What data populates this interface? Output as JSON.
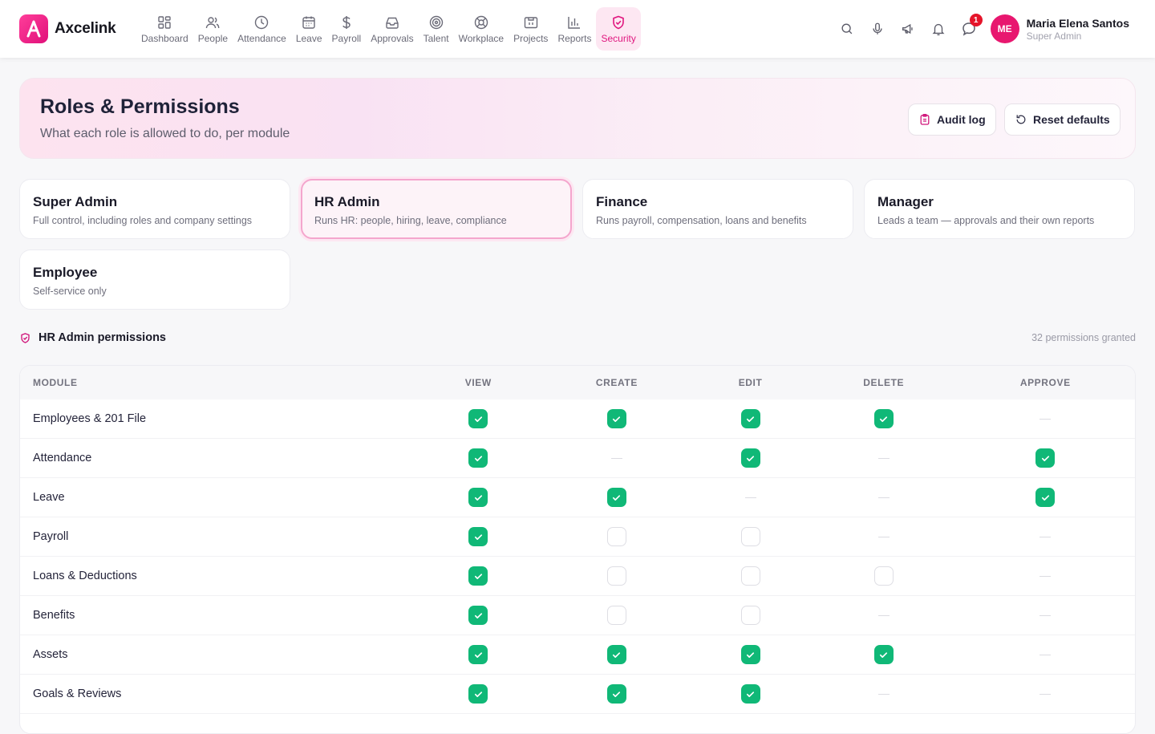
{
  "app": {
    "name": "Axcelink"
  },
  "nav": [
    {
      "label": "Dashboard",
      "icon": "grid-icon",
      "active": false
    },
    {
      "label": "People",
      "icon": "people-icon",
      "active": false
    },
    {
      "label": "Attendance",
      "icon": "clock-icon",
      "active": false
    },
    {
      "label": "Leave",
      "icon": "calendar-icon",
      "active": false
    },
    {
      "label": "Payroll",
      "icon": "dollar-icon",
      "active": false
    },
    {
      "label": "Approvals",
      "icon": "inbox-icon",
      "active": false
    },
    {
      "label": "Talent",
      "icon": "target-icon",
      "active": false
    },
    {
      "label": "Workplace",
      "icon": "lifebuoy-icon",
      "active": false
    },
    {
      "label": "Projects",
      "icon": "folder-icon",
      "active": false
    },
    {
      "label": "Reports",
      "icon": "bar-chart-icon",
      "active": false
    },
    {
      "label": "Security",
      "icon": "shield-icon",
      "active": true
    }
  ],
  "header_actions": {
    "notification_badge": "1"
  },
  "user": {
    "initials": "ME",
    "name": "Maria Elena Santos",
    "role": "Super Admin"
  },
  "hero": {
    "title": "Roles & Permissions",
    "subtitle": "What each role is allowed to do, per module",
    "audit_label": "Audit log",
    "reset_label": "Reset defaults"
  },
  "roles": [
    {
      "title": "Super Admin",
      "desc": "Full control, including roles and company settings",
      "selected": false
    },
    {
      "title": "HR Admin",
      "desc": "Runs HR: people, hiring, leave, compliance",
      "selected": true
    },
    {
      "title": "Finance",
      "desc": "Runs payroll, compensation, loans and benefits",
      "selected": false
    },
    {
      "title": "Manager",
      "desc": "Leads a team — approvals and their own reports",
      "selected": false
    },
    {
      "title": "Employee",
      "desc": "Self-service only",
      "selected": false
    }
  ],
  "section": {
    "title": "HR Admin permissions",
    "count": "32 permissions granted"
  },
  "table": {
    "columns": [
      "MODULE",
      "VIEW",
      "CREATE",
      "EDIT",
      "DELETE",
      "APPROVE"
    ],
    "rows": [
      {
        "module": "Employees & 201 File",
        "perms": [
          "on",
          "on",
          "on",
          "on",
          "na"
        ]
      },
      {
        "module": "Attendance",
        "perms": [
          "on",
          "na",
          "on",
          "na",
          "on"
        ]
      },
      {
        "module": "Leave",
        "perms": [
          "on",
          "on",
          "na",
          "na",
          "on"
        ]
      },
      {
        "module": "Payroll",
        "perms": [
          "on",
          "off",
          "off",
          "na",
          "na"
        ]
      },
      {
        "module": "Loans & Deductions",
        "perms": [
          "on",
          "off",
          "off",
          "off",
          "na"
        ]
      },
      {
        "module": "Benefits",
        "perms": [
          "on",
          "off",
          "off",
          "na",
          "na"
        ]
      },
      {
        "module": "Assets",
        "perms": [
          "on",
          "on",
          "on",
          "on",
          "na"
        ]
      },
      {
        "module": "Goals & Reviews",
        "perms": [
          "on",
          "on",
          "on",
          "na",
          "na"
        ]
      },
      {
        "module": "",
        "perms": [
          "",
          "",
          "",
          "",
          ""
        ]
      }
    ]
  },
  "colors": {
    "accent": "#e0177f",
    "check": "#10b877",
    "badge": "#e5142a"
  }
}
